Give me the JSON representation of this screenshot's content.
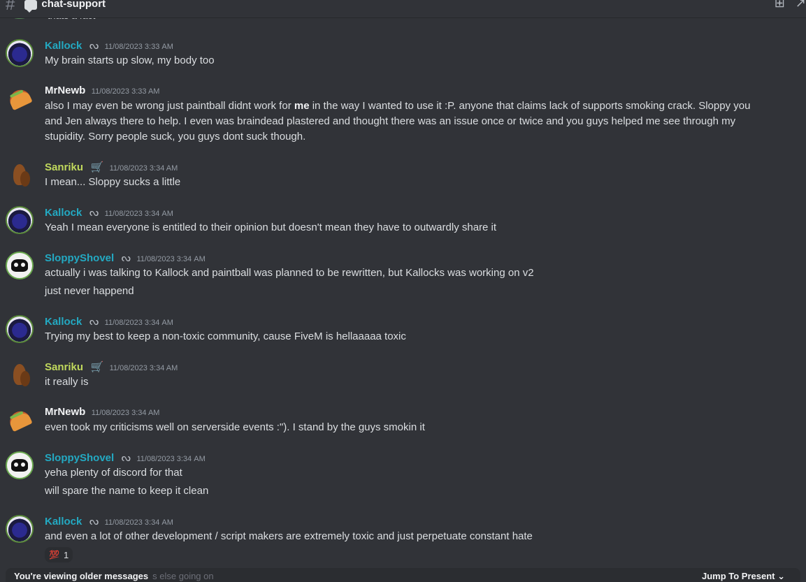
{
  "channel": {
    "name": "chat-support"
  },
  "partial_top": "thats a fact",
  "messages": [
    {
      "user": "Kallock",
      "color": "#23a9c2",
      "badge": "ᔓ",
      "ts": "11/08/2023 3:33 AM",
      "lines": [
        "My brain starts up slow, my body too"
      ]
    },
    {
      "user": "MrNewb",
      "color": "#f2f3f5",
      "badge": "",
      "ts": "11/08/2023 3:33 AM",
      "text_before": "also I may even be wrong just paintball didnt work for ",
      "text_bold": "me",
      "text_after": " in the way I wanted to use it :P. anyone that claims lack of supports smoking crack. Sloppy you and Jen always there to help. I even was braindead plastered and thought there was an issue once or twice and you guys helped me see through my stupidity. Sorry people suck, you guys dont suck though."
    },
    {
      "user": "Sanriku",
      "color": "#c1d95d",
      "badge": "🛒",
      "ts": "11/08/2023 3:34 AM",
      "lines": [
        "I mean... Sloppy sucks a little"
      ]
    },
    {
      "user": "Kallock",
      "color": "#23a9c2",
      "badge": "ᔓ",
      "ts": "11/08/2023 3:34 AM",
      "lines": [
        "Yeah I mean everyone is entitled to their opinion but doesn't mean they have to outwardly share it"
      ]
    },
    {
      "user": "SloppyShovel",
      "color": "#23a9c2",
      "badge": "ᔓ",
      "ts": "11/08/2023 3:34 AM",
      "lines": [
        "actually i was talking to Kallock and paintball was planned to be rewritten, but Kallocks was working on v2",
        "just never happend"
      ]
    },
    {
      "user": "Kallock",
      "color": "#23a9c2",
      "badge": "ᔓ",
      "ts": "11/08/2023 3:34 AM",
      "lines": [
        "Trying my best to keep a non-toxic community, cause FiveM is hellaaaaa toxic"
      ]
    },
    {
      "user": "Sanriku",
      "color": "#c1d95d",
      "badge": "🛒",
      "ts": "11/08/2023 3:34 AM",
      "lines": [
        "it really is"
      ]
    },
    {
      "user": "MrNewb",
      "color": "#f2f3f5",
      "badge": "",
      "ts": "11/08/2023 3:34 AM",
      "lines": [
        "even took my criticisms well on serverside events :\"). I stand by the guys smokin it"
      ]
    },
    {
      "user": "SloppyShovel",
      "color": "#23a9c2",
      "badge": "ᔓ",
      "ts": "11/08/2023 3:34 AM",
      "lines": [
        "yeha plenty of discord for that",
        "will spare the name to keep it clean"
      ]
    },
    {
      "user": "Kallock",
      "color": "#23a9c2",
      "badge": "ᔓ",
      "ts": "11/08/2023 3:34 AM",
      "lines": [
        "and even a lot of other development / script makers are extremely toxic and just perpetuate constant hate"
      ],
      "reaction": {
        "emoji": "💯",
        "count": "1"
      }
    }
  ],
  "bottom": {
    "notice": "You're viewing older messages",
    "ghost": "s else going on",
    "jump": "Jump To Present"
  }
}
